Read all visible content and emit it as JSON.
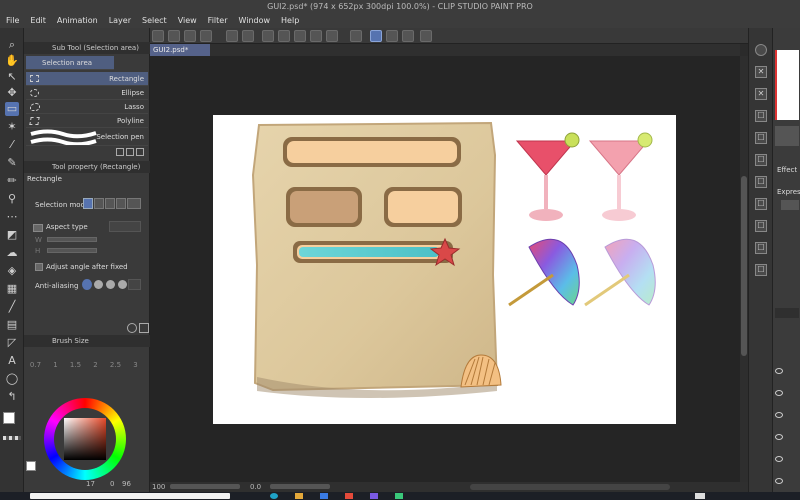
{
  "window": {
    "title": "GUI2.psd* (974 x 652px 300dpi 100.0%) - CLIP STUDIO PAINT PRO"
  },
  "menu": [
    "File",
    "Edit",
    "Animation",
    "Layer",
    "Select",
    "View",
    "Filter",
    "Window",
    "Help"
  ],
  "document_tab": {
    "label": "GUI2.psd*"
  },
  "sub_tool_panel": {
    "title": "Sub Tool (Selection area)",
    "group": "Selection area",
    "items": [
      "Rectangle",
      "Ellipse",
      "Lasso",
      "Polyline",
      "Selection pen"
    ]
  },
  "tool_property": {
    "title": "Tool property (Rectangle)",
    "tool_name": "Rectangle",
    "selection_mode_label": "Selection mode",
    "aspect_type_label": "Aspect type",
    "w_label": "W",
    "h_label": "H",
    "adjust_angle_label": "Adjust angle after fixed",
    "anti_aliasing_label": "Anti-aliasing"
  },
  "brush_size": {
    "title": "Brush Size",
    "values": [
      "0.7",
      "1",
      "1.5",
      "2",
      "2.5",
      "3"
    ]
  },
  "color": {
    "values": [
      "17",
      "0",
      "96"
    ]
  },
  "status": {
    "zoom": "100",
    "angle": "0.0"
  },
  "right_panel": {
    "effect_label": "Effect",
    "expression_label": "Express"
  },
  "colors": {
    "accent": "#5673b0",
    "sand": "#e2cfa5",
    "button_peach": "#f6cf9e",
    "button_tan": "#c9a078",
    "progress_fill": "#5fd0d0",
    "star": "#d94848",
    "drink": "#e8506a",
    "drink_light": "#f3a1ae"
  }
}
